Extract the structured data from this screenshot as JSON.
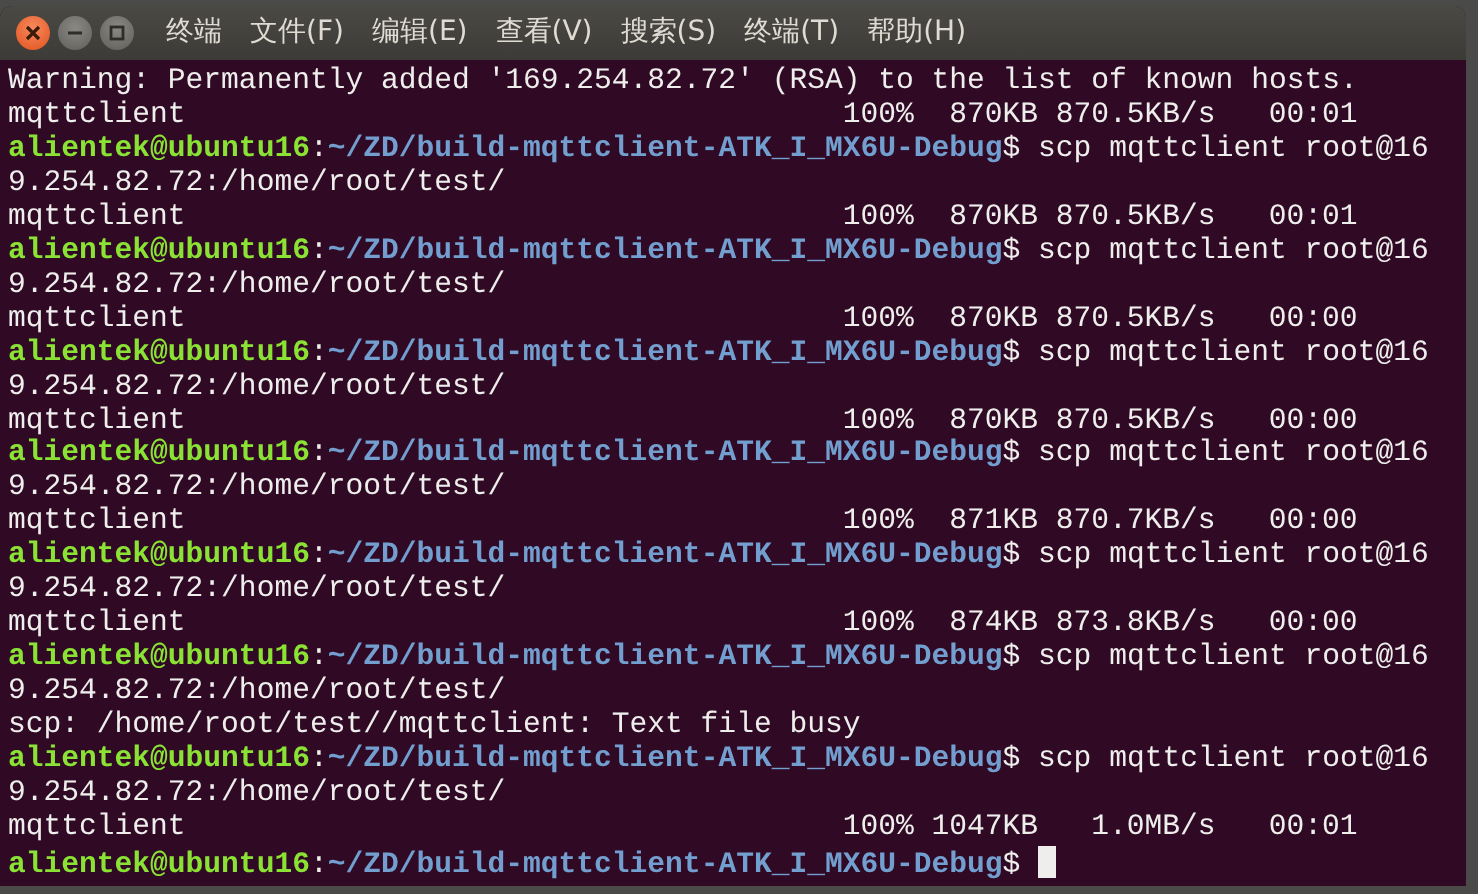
{
  "window": {
    "title": "终端",
    "menu": [
      "文件(F)",
      "编辑(E)",
      "查看(V)",
      "搜索(S)",
      "终端(T)",
      "帮助(H)"
    ]
  },
  "terminal": {
    "lines": [
      {
        "kind": "text",
        "text": "Warning: Permanently added '169.254.82.72' (RSA) to the list of known hosts."
      },
      {
        "kind": "progress",
        "file": "mqttclient",
        "percent": "100%",
        "size": "870KB",
        "rate": "870.5KB/s",
        "eta": "00:01"
      },
      {
        "kind": "prompt",
        "user_host": "alientek@ubuntu16",
        "separator": ":",
        "path": "~/ZD/build-mqttclient-ATK_I_MX6U-Debug",
        "prompt_char": "$",
        "command": "scp mqttclient root@169.254.82.72:/home/root/test/",
        "cursor": false
      },
      {
        "kind": "progress",
        "file": "mqttclient",
        "percent": "100%",
        "size": "870KB",
        "rate": "870.5KB/s",
        "eta": "00:01"
      },
      {
        "kind": "prompt",
        "user_host": "alientek@ubuntu16",
        "separator": ":",
        "path": "~/ZD/build-mqttclient-ATK_I_MX6U-Debug",
        "prompt_char": "$",
        "command": "scp mqttclient root@169.254.82.72:/home/root/test/",
        "cursor": false
      },
      {
        "kind": "progress",
        "file": "mqttclient",
        "percent": "100%",
        "size": "870KB",
        "rate": "870.5KB/s",
        "eta": "00:00"
      },
      {
        "kind": "prompt",
        "user_host": "alientek@ubuntu16",
        "separator": ":",
        "path": "~/ZD/build-mqttclient-ATK_I_MX6U-Debug",
        "prompt_char": "$",
        "command": "scp mqttclient root@169.254.82.72:/home/root/test/",
        "cursor": false
      },
      {
        "kind": "progress",
        "file": "mqttclient",
        "percent": "100%",
        "size": "870KB",
        "rate": "870.5KB/s",
        "eta": "00:00"
      },
      {
        "kind": "prompt",
        "user_host": "alientek@ubuntu16",
        "separator": ":",
        "path": "~/ZD/build-mqttclient-ATK_I_MX6U-Debug",
        "prompt_char": "$",
        "command": "scp mqttclient root@169.254.82.72:/home/root/test/",
        "cursor": false
      },
      {
        "kind": "progress",
        "file": "mqttclient",
        "percent": "100%",
        "size": "871KB",
        "rate": "870.7KB/s",
        "eta": "00:00"
      },
      {
        "kind": "prompt",
        "user_host": "alientek@ubuntu16",
        "separator": ":",
        "path": "~/ZD/build-mqttclient-ATK_I_MX6U-Debug",
        "prompt_char": "$",
        "command": "scp mqttclient root@169.254.82.72:/home/root/test/",
        "cursor": false
      },
      {
        "kind": "progress",
        "file": "mqttclient",
        "percent": "100%",
        "size": "874KB",
        "rate": "873.8KB/s",
        "eta": "00:00"
      },
      {
        "kind": "prompt",
        "user_host": "alientek@ubuntu16",
        "separator": ":",
        "path": "~/ZD/build-mqttclient-ATK_I_MX6U-Debug",
        "prompt_char": "$",
        "command": "scp mqttclient root@169.254.82.72:/home/root/test/",
        "cursor": false
      },
      {
        "kind": "text",
        "text": "scp: /home/root/test//mqttclient: Text file busy"
      },
      {
        "kind": "prompt",
        "user_host": "alientek@ubuntu16",
        "separator": ":",
        "path": "~/ZD/build-mqttclient-ATK_I_MX6U-Debug",
        "prompt_char": "$",
        "command": "scp mqttclient root@169.254.82.72:/home/root/test/",
        "cursor": false
      },
      {
        "kind": "progress",
        "file": "mqttclient",
        "percent": "100%",
        "size": "1047KB",
        "rate": "1.0MB/s",
        "eta": "00:01"
      },
      {
        "kind": "prompt",
        "user_host": "alientek@ubuntu16",
        "separator": ":",
        "path": "~/ZD/build-mqttclient-ATK_I_MX6U-Debug",
        "prompt_char": "$",
        "cursor": true
      }
    ]
  }
}
